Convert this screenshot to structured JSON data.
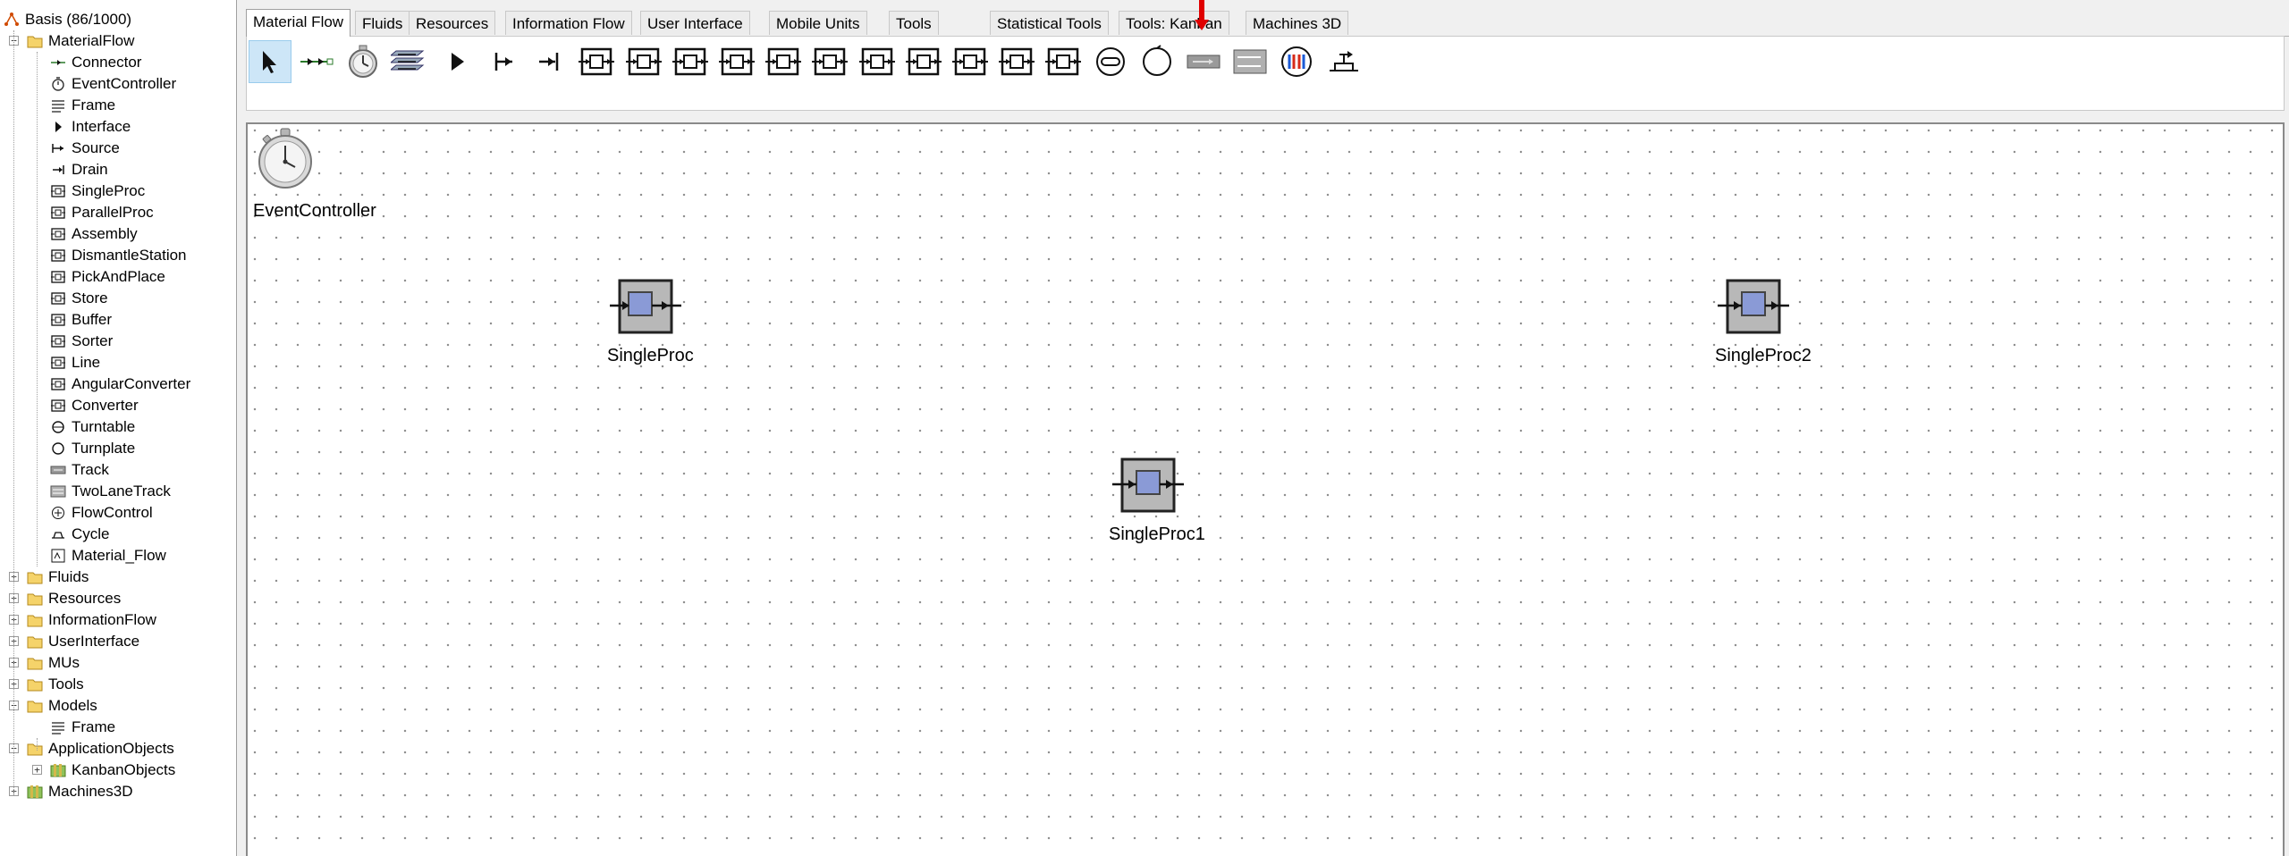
{
  "tree": {
    "root": {
      "label": "Basis (86/1000)",
      "icon": "basis-icon"
    },
    "material_flow": {
      "label": "MaterialFlow",
      "items": [
        {
          "label": "Connector",
          "icon": "connector-icon"
        },
        {
          "label": "EventController",
          "icon": "eventcontroller-icon"
        },
        {
          "label": "Frame",
          "icon": "frame-icon"
        },
        {
          "label": "Interface",
          "icon": "interface-icon"
        },
        {
          "label": "Source",
          "icon": "source-icon"
        },
        {
          "label": "Drain",
          "icon": "drain-icon"
        },
        {
          "label": "SingleProc",
          "icon": "singleproc-icon"
        },
        {
          "label": "ParallelProc",
          "icon": "parallelproc-icon"
        },
        {
          "label": "Assembly",
          "icon": "assembly-icon"
        },
        {
          "label": "DismantleStation",
          "icon": "dismantlestation-icon"
        },
        {
          "label": "PickAndPlace",
          "icon": "pickandplace-icon"
        },
        {
          "label": "Store",
          "icon": "store-icon"
        },
        {
          "label": "Buffer",
          "icon": "buffer-icon"
        },
        {
          "label": "Sorter",
          "icon": "sorter-icon"
        },
        {
          "label": "Line",
          "icon": "line-icon"
        },
        {
          "label": "AngularConverter",
          "icon": "angularconverter-icon"
        },
        {
          "label": "Converter",
          "icon": "converter-icon"
        },
        {
          "label": "Turntable",
          "icon": "turntable-icon"
        },
        {
          "label": "Turnplate",
          "icon": "turnplate-icon"
        },
        {
          "label": "Track",
          "icon": "track-icon"
        },
        {
          "label": "TwoLaneTrack",
          "icon": "twolanetrack-icon"
        },
        {
          "label": "FlowControl",
          "icon": "flowcontrol-icon"
        },
        {
          "label": "Cycle",
          "icon": "cycle-icon"
        },
        {
          "label": "Material_Flow",
          "icon": "material-flow-icon"
        }
      ]
    },
    "folders": [
      "Fluids",
      "Resources",
      "InformationFlow",
      "UserInterface",
      "MUs",
      "Tools"
    ],
    "models": {
      "label": "Models",
      "frame": "Frame"
    },
    "application_objects": {
      "label": "ApplicationObjects",
      "kanban": "KanbanObjects"
    },
    "machines3d": "Machines3D"
  },
  "tabs": [
    {
      "label": "Material Flow",
      "active": true
    },
    {
      "label": "Fluids"
    },
    {
      "label": "Resources"
    },
    {
      "label": "Information Flow"
    },
    {
      "label": "User Interface"
    },
    {
      "label": "Mobile Units"
    },
    {
      "label": "Tools"
    },
    {
      "label": "Statistical Tools"
    },
    {
      "label": "Tools: Kanban"
    },
    {
      "label": "Machines 3D"
    }
  ],
  "toolbar": [
    "pointer-tool-icon",
    "connector-tool-icon",
    "eventcontroller-tool-icon",
    "frame-tool-icon",
    "interface-tool-icon",
    "source-tool-icon",
    "drain-tool-icon",
    "singleproc-tool-icon",
    "parallelproc-tool-icon",
    "assembly-tool-icon",
    "dismantlestation-tool-icon",
    "pickandplace-tool-icon",
    "store-tool-icon",
    "buffer-tool-icon",
    "sorter-tool-icon",
    "line-tool-icon",
    "angularconverter-tool-icon",
    "converter-tool-icon",
    "turntable-tool-icon",
    "turnplate-tool-icon",
    "track-tool-icon",
    "twolanetrack-tool-icon",
    "flowcontrol-tool-icon",
    "cycle-tool-icon"
  ],
  "canvas": {
    "event_controller_label": "EventController",
    "singleproc_label": "SingleProc",
    "singleproc1_label": "SingleProc1",
    "singleproc2_label": "SingleProc2"
  },
  "colors": {
    "accent_arrow": "#e00000",
    "selected_tool": "#cde6f7",
    "station_body": "#b8b8b8",
    "station_core": "#8a9ad6",
    "folder": "#f5d36a"
  }
}
